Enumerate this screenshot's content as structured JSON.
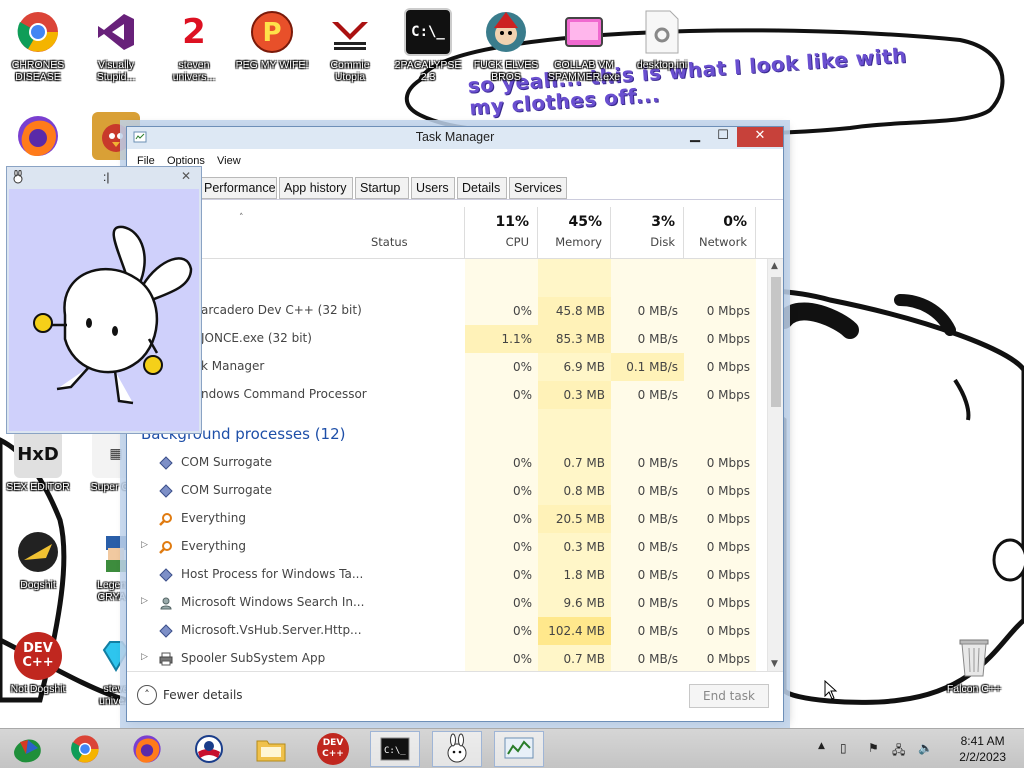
{
  "desktop": {
    "bubble_text": "so yeah... this is what I look like with my clothes off...",
    "icons": [
      {
        "label": "CHRONES\nDISEASE"
      },
      {
        "label": "Visually\nStupid..."
      },
      {
        "label": "steven\nunivers..."
      },
      {
        "label": "PEG MY WIFE!"
      },
      {
        "label": "Commie\nUtopia"
      },
      {
        "label": "2PACALYPSE\n2.3"
      },
      {
        "label": "FUCK ELVES\nBROS"
      },
      {
        "label": "COLLAB VM\nSPAMMER.exe"
      },
      {
        "label": "desktop.ini"
      },
      {
        "label": "SEX EDITOR"
      },
      {
        "label": "Super Gr..."
      },
      {
        "label": "Dogshit"
      },
      {
        "label": "Legen...\nCRYA..."
      },
      {
        "label": "Not Dogshit"
      },
      {
        "label": "steve\nunive..."
      },
      {
        "label": "Falcon C++"
      }
    ]
  },
  "bunny_window": {
    "title": ":|"
  },
  "task_manager": {
    "title": "Task Manager",
    "menu": [
      "File",
      "Options",
      "View"
    ],
    "tabs": [
      "Performance",
      "App history",
      "Startup",
      "Users",
      "Details",
      "Services"
    ],
    "columns": {
      "status": "Status",
      "cpu": {
        "pct": "11%",
        "name": "CPU"
      },
      "memory": {
        "pct": "45%",
        "name": "Memory"
      },
      "disk": {
        "pct": "3%",
        "name": "Disk"
      },
      "network": {
        "pct": "0%",
        "name": "Network"
      }
    },
    "apps": [
      {
        "name": "arcadero Dev C++ (32 bit)",
        "cpu": "0%",
        "memory": "45.8 MB",
        "disk": "0 MB/s",
        "network": "0 Mbps"
      },
      {
        "name": "JONCE.exe (32 bit)",
        "cpu": "1.1%",
        "memory": "85.3 MB",
        "disk": "0 MB/s",
        "network": "0 Mbps"
      },
      {
        "name": "k Manager",
        "cpu": "0%",
        "memory": "6.9 MB",
        "disk": "0.1 MB/s",
        "network": "0 Mbps"
      },
      {
        "name": "ndows Command Processor",
        "cpu": "0%",
        "memory": "0.3 MB",
        "disk": "0 MB/s",
        "network": "0 Mbps"
      }
    ],
    "background_header": "Background processes (12)",
    "background": [
      {
        "name": "COM Surrogate",
        "icon": "cube-icon",
        "cpu": "0%",
        "memory": "0.7 MB",
        "disk": "0 MB/s",
        "network": "0 Mbps"
      },
      {
        "name": "COM Surrogate",
        "icon": "cube-icon",
        "cpu": "0%",
        "memory": "0.8 MB",
        "disk": "0 MB/s",
        "network": "0 Mbps"
      },
      {
        "name": "Everything",
        "icon": "magnifier-icon",
        "cpu": "0%",
        "memory": "20.5 MB",
        "disk": "0 MB/s",
        "network": "0 Mbps"
      },
      {
        "name": "Everything",
        "icon": "magnifier-icon",
        "cpu": "0%",
        "memory": "0.3 MB",
        "disk": "0 MB/s",
        "network": "0 Mbps"
      },
      {
        "name": "Host Process for Windows Ta...",
        "icon": "cube-icon",
        "cpu": "0%",
        "memory": "1.8 MB",
        "disk": "0 MB/s",
        "network": "0 Mbps"
      },
      {
        "name": "Microsoft Windows Search In...",
        "icon": "search-person-icon",
        "cpu": "0%",
        "memory": "9.6 MB",
        "disk": "0 MB/s",
        "network": "0 Mbps"
      },
      {
        "name": "Microsoft.VsHub.Server.Http...",
        "icon": "cube-icon",
        "cpu": "0%",
        "memory": "102.4 MB",
        "disk": "0 MB/s",
        "network": "0 Mbps"
      },
      {
        "name": "Spooler SubSystem App",
        "icon": "printer-icon",
        "cpu": "0%",
        "memory": "0.7 MB",
        "disk": "0 MB/s",
        "network": "0 Mbps"
      }
    ],
    "footer": {
      "fewer_details": "Fewer details",
      "end_task": "End task"
    }
  },
  "taskbar": {
    "clock_time": "8:41 AM",
    "clock_date": "2/2/2023",
    "items": [
      "start-orb-icon",
      "chrome-icon",
      "firefox-icon",
      "obama-icon",
      "folder-icon",
      "devcpp-icon",
      "cmd-icon",
      "bunny-icon",
      "taskmgr-icon"
    ]
  },
  "colors": {
    "section_blue": "#1e4fa8",
    "close_red": "#c7413a",
    "heat_low": "#fff8d8",
    "heat_mid": "#fff2b8",
    "heat_high": "#ffe88c"
  }
}
